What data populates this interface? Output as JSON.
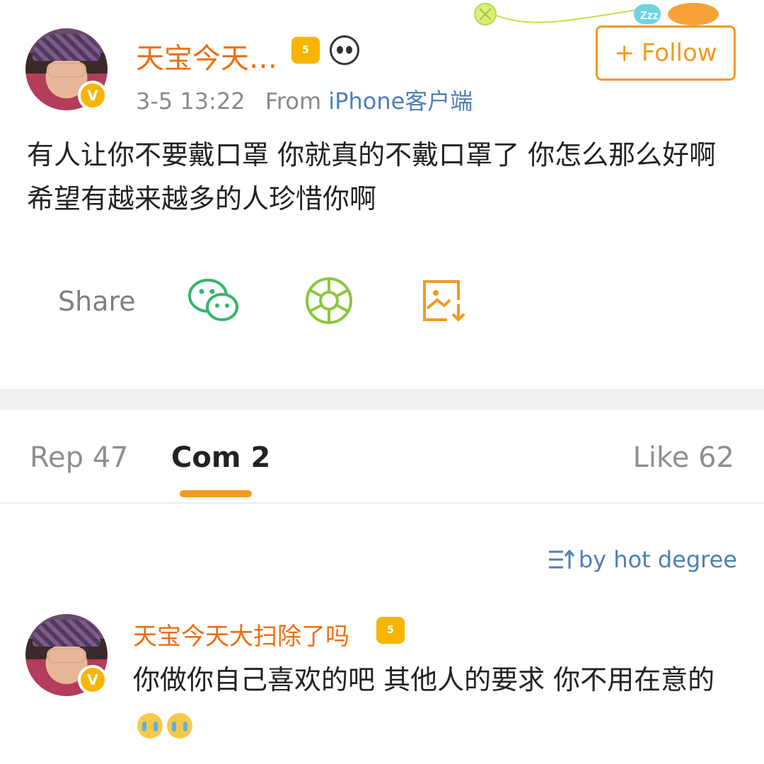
{
  "post": {
    "author_name": "天宝今天…",
    "level_badge": "5",
    "verified_badge": "V",
    "timestamp": "3-5 13:22",
    "from_label": "From",
    "source": "iPhone客户端",
    "follow_label": "Follow",
    "follow_symbol": "+",
    "content": "有人让你不要戴口罩 你就真的不戴口罩了 你怎么那么好啊 希望有越来越多的人珍惜你啊"
  },
  "share": {
    "label": "Share",
    "targets": [
      "wechat-icon",
      "moments-icon",
      "save-image-icon"
    ]
  },
  "decor": {
    "sleep_text": "Zzz"
  },
  "tabs": [
    {
      "label": "Rep 47"
    },
    {
      "label": "Com 2"
    },
    {
      "label": "Like 62"
    }
  ],
  "sort": {
    "label": "by hot degree"
  },
  "comments": [
    {
      "author_name": "天宝今天大扫除了吗",
      "level_badge": "5",
      "verified_badge": "V",
      "text": "你做你自己喜欢的吧 其他人的要求 你不用在意的"
    }
  ],
  "colors": {
    "accent": "#f39a1f",
    "username": "#f06d11",
    "link": "#4f7fb5",
    "wechat": "#34b56b",
    "moments": "#8cc63f",
    "verified": "#f7b500"
  }
}
